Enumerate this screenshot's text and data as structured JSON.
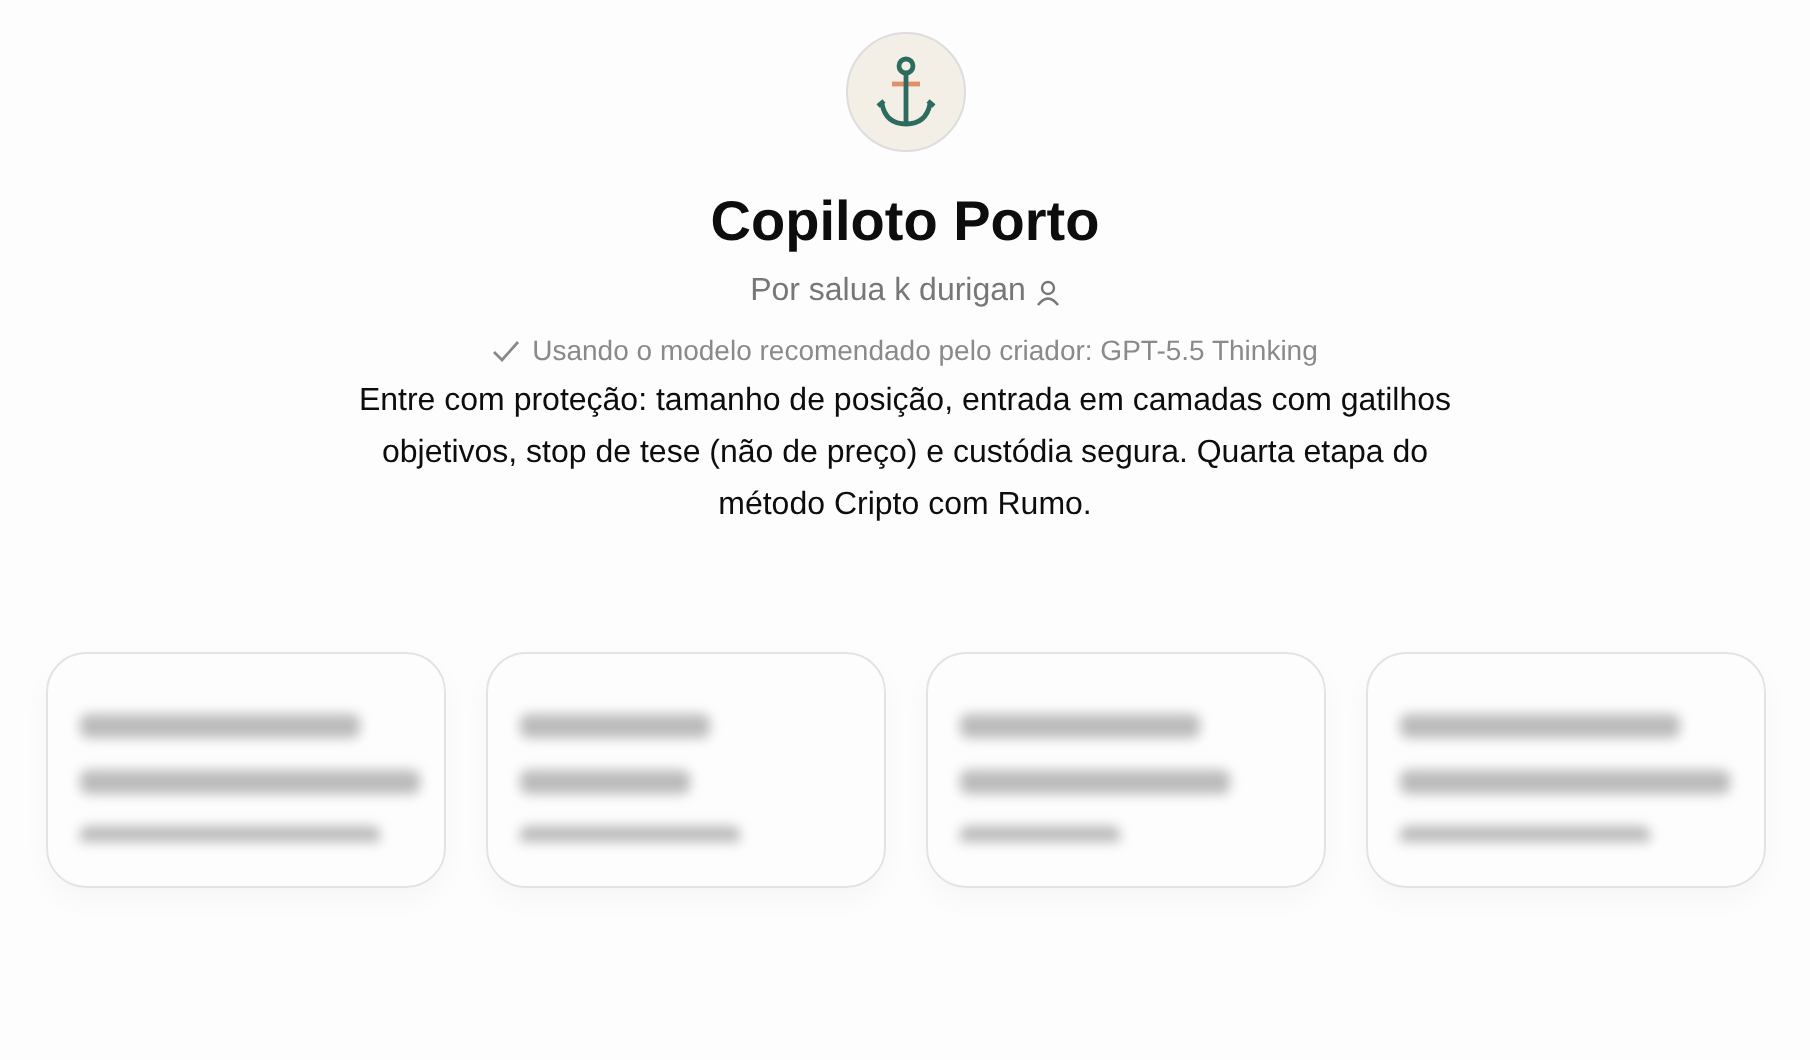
{
  "gpt": {
    "name": "Copiloto Porto",
    "author": "Por salua k durigan",
    "model_note": "Usando o modelo recomendado pelo criador: GPT-5.5 Thinking",
    "description": "Entre com proteção: tamanho de posição, entrada em camadas com gatilhos objetivos, stop de tese (não de preço) e custódia segura. Quarta etapa do método Cripto com Rumo."
  },
  "suggestions": [
    {
      "kind": "blurred"
    },
    {
      "kind": "blurred"
    },
    {
      "kind": "blurred"
    },
    {
      "kind": "blurred"
    }
  ]
}
